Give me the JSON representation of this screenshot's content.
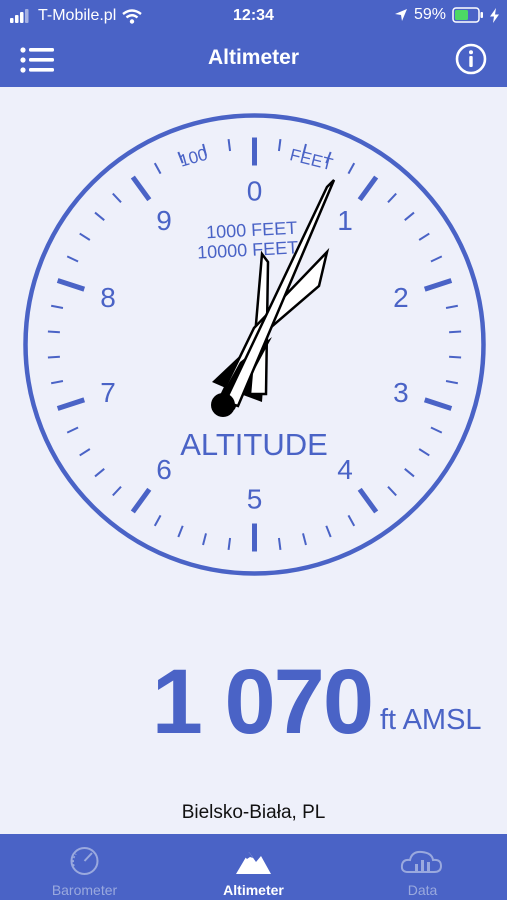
{
  "status_bar": {
    "carrier": "T-Mobile.pl",
    "time": "12:34",
    "battery": "59%",
    "battery_level": 0.59,
    "icons": [
      "signal-icon",
      "wifi-icon",
      "location-arrow-icon",
      "battery-icon",
      "charging-icon"
    ]
  },
  "header": {
    "title": "Altimeter",
    "menu_icon": "hamburger-menu-icon",
    "info_icon": "info-icon"
  },
  "gauge": {
    "numbers": [
      "0",
      "1",
      "2",
      "3",
      "4",
      "5",
      "6",
      "7",
      "8",
      "9"
    ],
    "scale_100": "100",
    "scale_feet": "FEET",
    "scale_1000": "1000 FEET",
    "scale_10000": "10000 FEET",
    "label": "ALTITUDE",
    "value_feet": 1070,
    "colors": {
      "accent": "#4a63c6",
      "face": "#eef0fa",
      "needle": "#000000"
    }
  },
  "reading": {
    "value": "1 070",
    "unit": "ft AMSL"
  },
  "location": "Bielsko-Biała, PL",
  "tabs": [
    {
      "label": "Barometer",
      "icon": "gauge-icon",
      "active": false
    },
    {
      "label": "Altimeter",
      "icon": "mountain-icon",
      "active": true
    },
    {
      "label": "Data",
      "icon": "cloud-chart-icon",
      "active": false
    }
  ]
}
